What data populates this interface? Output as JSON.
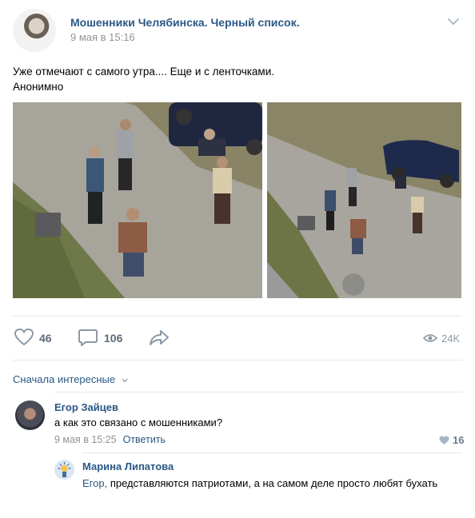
{
  "post": {
    "group_name": "Мошенники Челябинска. Черный список.",
    "date": "9 мая в 15:16",
    "text_line1": "Уже отмечают с самого утра.... Еще и с ленточками.",
    "text_line2": "Анонимно"
  },
  "actions": {
    "likes": "46",
    "comments": "106",
    "views": "24K"
  },
  "comments_sort": "Сначала интересные",
  "comments": [
    {
      "author": "Егор Зайцев",
      "text": "а как это связано с мошенниками?",
      "date": "9 мая в 15:25",
      "reply_label": "Ответить",
      "likes": "16"
    },
    {
      "author": "Марина Липатова",
      "addressee": "Егор,",
      "text": " представляются патриотами, а на самом деле просто любят бухать"
    }
  ],
  "colors": {
    "link": "#2a5885",
    "meta": "#939393",
    "icon": "#8d99a6"
  }
}
